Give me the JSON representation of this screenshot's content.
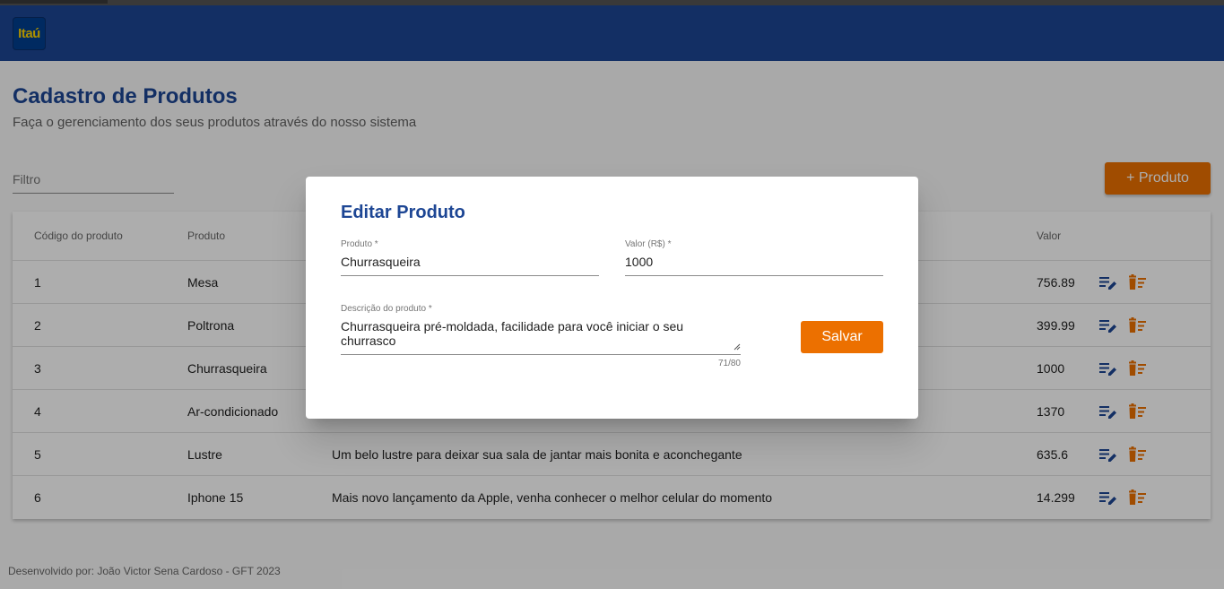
{
  "brand": {
    "logo_text": "Itaú"
  },
  "page": {
    "title": "Cadastro de Produtos",
    "subtitle": "Faça o gerenciamento dos seus produtos através do nosso sistema"
  },
  "filter": {
    "placeholder": "Filtro"
  },
  "add_button": {
    "label": "+ Produto"
  },
  "table": {
    "headers": {
      "code": "Código do produto",
      "product": "Produto",
      "value": "Valor"
    },
    "rows": [
      {
        "code": "1",
        "product": "Mesa",
        "description": "",
        "value": "756.89"
      },
      {
        "code": "2",
        "product": "Poltrona",
        "description": "",
        "value": "399.99"
      },
      {
        "code": "3",
        "product": "Churrasqueira",
        "description": "",
        "value": "1000"
      },
      {
        "code": "4",
        "product": "Ar-condicionado",
        "description": "",
        "value": "1370"
      },
      {
        "code": "5",
        "product": "Lustre",
        "description": "Um belo lustre para deixar sua sala de jantar mais bonita e aconchegante",
        "value": "635.6"
      },
      {
        "code": "6",
        "product": "Iphone 15",
        "description": "Mais novo lançamento da Apple, venha conhecer o melhor celular do momento",
        "value": "14.299"
      }
    ]
  },
  "footer": {
    "text": "Desenvolvido por: João Victor Sena Cardoso - GFT 2023"
  },
  "dialog": {
    "title": "Editar Produto",
    "product_label": "Produto *",
    "product_value": "Churrasqueira",
    "value_label": "Valor (R$) *",
    "value_value": "1000",
    "description_label": "Descrição do produto *",
    "description_value": "Churrasqueira pré-moldada, facilidade para você iniciar o seu churrasco",
    "counter": "71/80",
    "save_label": "Salvar"
  },
  "colors": {
    "primary": "#1d4694",
    "accent": "#ec7000"
  },
  "icons": {
    "edit": "edit-note-icon",
    "delete": "delete-sweep-icon"
  }
}
